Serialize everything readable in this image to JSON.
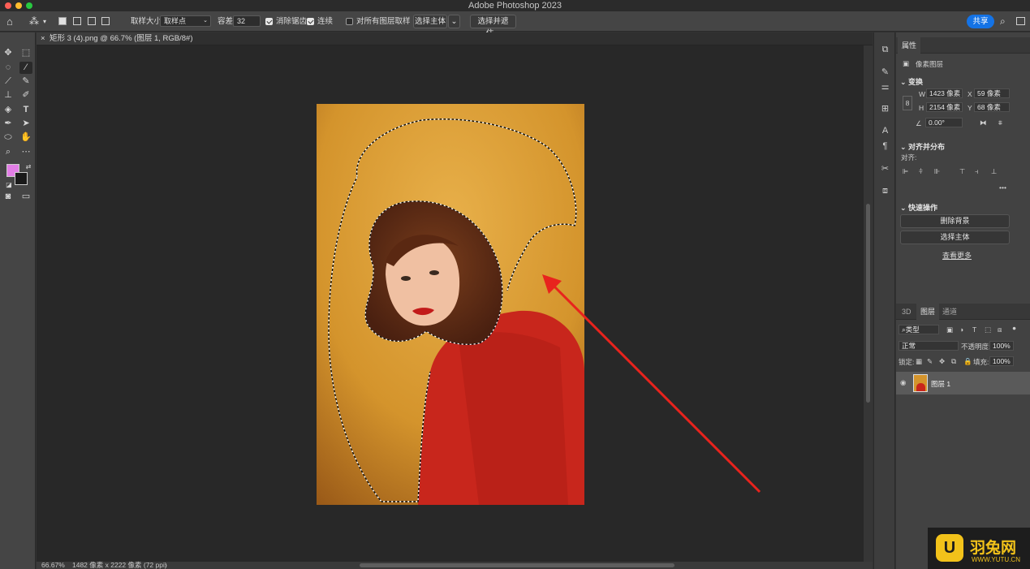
{
  "window": {
    "title": "Adobe Photoshop 2023"
  },
  "options_bar": {
    "sample_size_label": "取样大小:",
    "sample_size_value": "取样点",
    "tolerance_label": "容差:",
    "tolerance_value": "32",
    "anti_alias_label": "消除锯齿",
    "contiguous_label": "连续",
    "sample_all_layers_label": "对所有图层取样",
    "select_subject_label": "选择主体",
    "select_and_mask_label": "选择并遮住...",
    "share_label": "共享"
  },
  "document": {
    "tab_title": "矩形 3 (4).png @ 66.7% (图层 1, RGB/8#)",
    "zoom": "66.67%",
    "info": "1482 像素 x 2222 像素 (72 ppi)"
  },
  "properties": {
    "tab": "属性",
    "layer_type": "像素图层",
    "transform_title": "变换",
    "w_label": "W",
    "w_value": "1423 像素",
    "x_label": "X",
    "x_value": "59 像素",
    "h_label": "H",
    "h_value": "2154 像素",
    "y_label": "Y",
    "y_value": "68 像素",
    "angle_value": "0.00°",
    "align_title": "对齐并分布",
    "align_label": "对齐:",
    "quick_actions_title": "快速操作",
    "remove_bg_label": "删除背景",
    "select_subject_label": "选择主体",
    "view_more_label": "查看更多"
  },
  "layers": {
    "tabs": [
      "3D",
      "图层",
      "通道"
    ],
    "filter_kind": "类型",
    "blend_mode": "正常",
    "opacity_label": "不透明度:",
    "opacity_value": "100%",
    "lock_label": "锁定:",
    "fill_label": "填充:",
    "fill_value": "100%",
    "layer_name": "图层 1"
  },
  "watermark": {
    "brand": "羽兔网",
    "url": "WWW.YUTU.CN"
  },
  "colors": {
    "foreground": "#e27ee6",
    "background": "#1a1a1a",
    "accent": "#1473e6",
    "arrow": "#e8231d"
  }
}
